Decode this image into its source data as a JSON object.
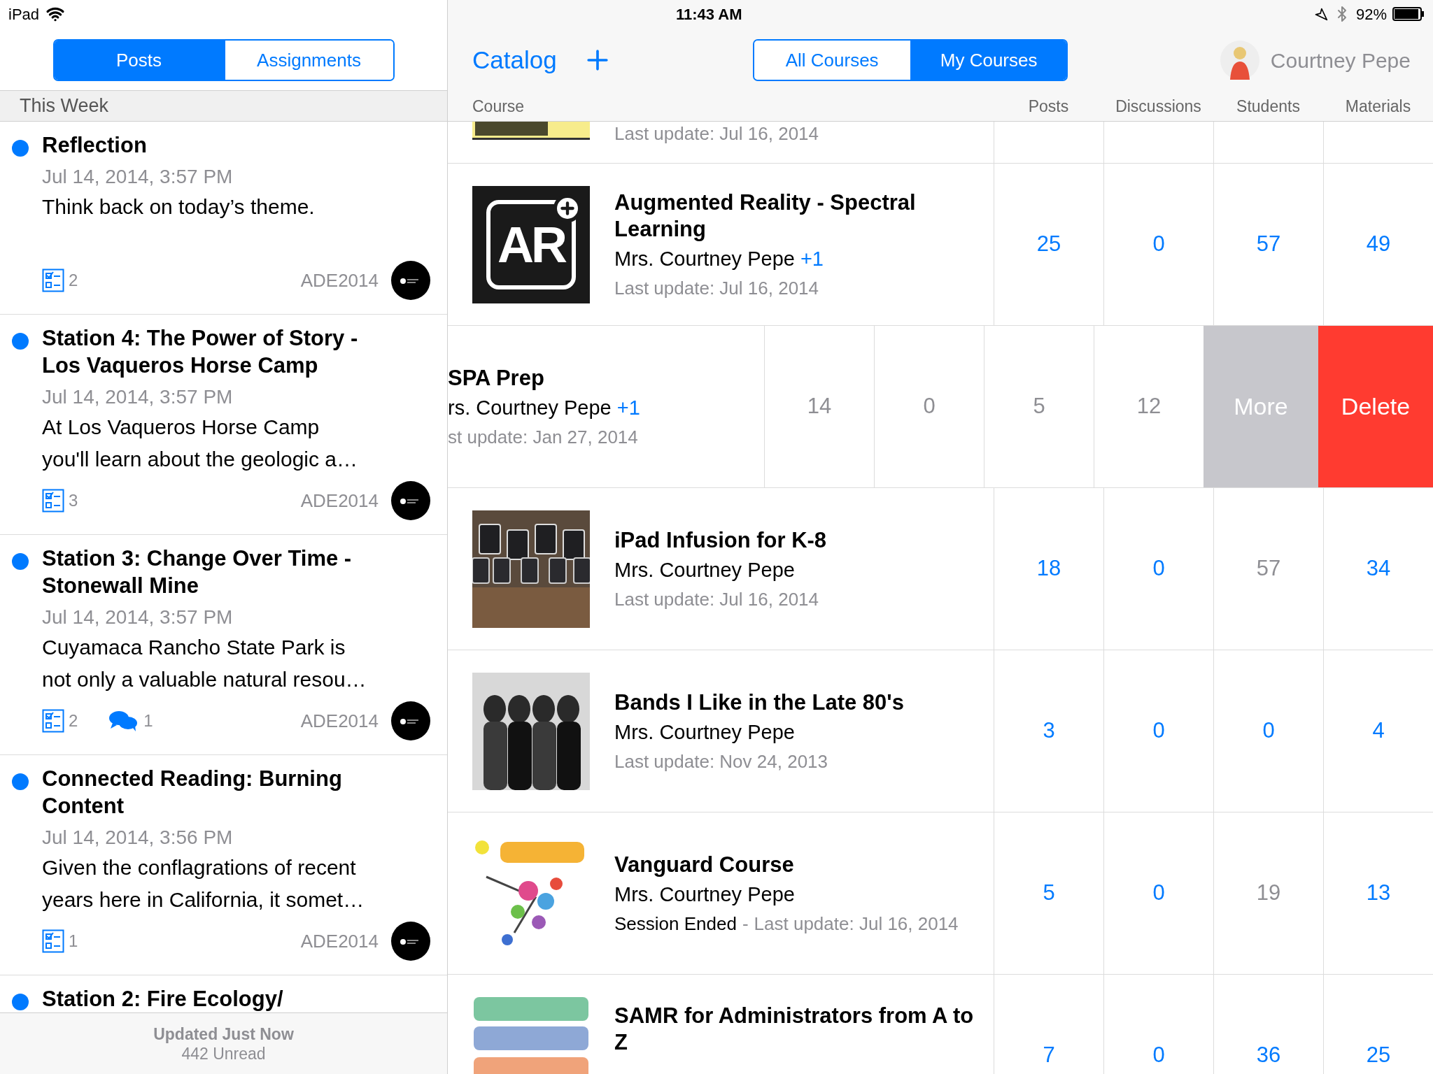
{
  "status_bar": {
    "device": "iPad",
    "time": "11:43 AM",
    "battery": "92%"
  },
  "left": {
    "tabs": [
      {
        "label": "Posts",
        "selected": true
      },
      {
        "label": "Assignments",
        "selected": false
      }
    ],
    "section": "This Week",
    "posts": [
      {
        "unread": true,
        "title_lines": [
          "Reflection"
        ],
        "date": "Jul 14, 2014, 3:57 PM",
        "body_lines": [
          "Think back on today’s theme."
        ],
        "assignments": "2",
        "group": "ADE2014"
      },
      {
        "unread": true,
        "title_lines": [
          "Station 4: The Power of Story -",
          "Los Vaqueros Horse Camp"
        ],
        "date": "Jul 14, 2014, 3:57 PM",
        "body_lines": [
          "At Los Vaqueros Horse Camp",
          "you'll learn about the geologic a…"
        ],
        "assignments": "3",
        "group": "ADE2014"
      },
      {
        "unread": true,
        "title_lines": [
          "Station 3: Change Over Time -",
          "Stonewall Mine"
        ],
        "date": "Jul 14, 2014, 3:57 PM",
        "body_lines": [
          "Cuyamaca Rancho State Park is",
          "not only a valuable natural resou…"
        ],
        "assignments": "2",
        "comments": "1",
        "group": "ADE2014"
      },
      {
        "unread": true,
        "title_lines": [
          "Connected Reading: Burning",
          "Content"
        ],
        "date": "Jul 14, 2014, 3:56 PM",
        "body_lines": [
          "Given the conflagrations of recent",
          "years here in California, it somet…"
        ],
        "assignments": "1",
        "group": "ADE2014"
      },
      {
        "unread": true,
        "title_lines": [
          "Station 2: Fire Ecology/"
        ]
      }
    ],
    "footer": {
      "updated": "Updated Just Now",
      "unread": "442 Unread"
    }
  },
  "right": {
    "title": "Catalog",
    "filters": [
      {
        "label": "All Courses",
        "selected": false
      },
      {
        "label": "My Courses",
        "selected": true
      }
    ],
    "user": "Courtney Pepe",
    "columns": [
      "Course",
      "Posts",
      "Discussions",
      "Students",
      "Materials"
    ],
    "rows": [
      {
        "kind": "partial",
        "updated": "Last update: Jul 16, 2014"
      },
      {
        "kind": "full",
        "thumbnail": {
          "kind": "logo",
          "text": "AR"
        },
        "title_lines": [
          "Augmented Reality - Spectral",
          "Learning"
        ],
        "teacher": "Mrs. Courtney Pepe",
        "extra": "+1",
        "updated": "Last update: Jul 16, 2014",
        "counts": [
          {
            "value": "25",
            "linked": true
          },
          {
            "value": "0",
            "linked": true
          },
          {
            "value": "57",
            "linked": true
          },
          {
            "value": "49",
            "linked": true
          }
        ]
      },
      {
        "kind": "swiped",
        "title_lines": [
          "SPA Prep"
        ],
        "teacher": "rs. Courtney Pepe",
        "extra": "+1",
        "updated": "st update: Jan 27, 2014",
        "counts": [
          {
            "value": "14",
            "linked": false
          },
          {
            "value": "0",
            "linked": false
          },
          {
            "value": "5",
            "linked": false
          },
          {
            "value": "12",
            "linked": false
          }
        ],
        "actions": [
          {
            "label": "More",
            "kind": "more"
          },
          {
            "label": "Delete",
            "kind": "delete"
          }
        ]
      },
      {
        "kind": "full",
        "thumbnail": {
          "kind": "ipads"
        },
        "title_lines": [
          "iPad Infusion for K-8"
        ],
        "teacher": "Mrs. Courtney Pepe",
        "updated": "Last update: Jul 16, 2014",
        "counts": [
          {
            "value": "18",
            "linked": true
          },
          {
            "value": "0",
            "linked": true
          },
          {
            "value": "57",
            "linked": false
          },
          {
            "value": "34",
            "linked": true
          }
        ]
      },
      {
        "kind": "full",
        "thumbnail": {
          "kind": "band"
        },
        "title_lines": [
          "Bands I Like in the Late 80's"
        ],
        "teacher": "Mrs. Courtney Pepe",
        "updated": "Last update: Nov 24, 2013",
        "counts": [
          {
            "value": "3",
            "linked": true
          },
          {
            "value": "0",
            "linked": true
          },
          {
            "value": "0",
            "linked": true
          },
          {
            "value": "4",
            "linked": true
          }
        ]
      },
      {
        "kind": "full",
        "thumbnail": {
          "kind": "sketch"
        },
        "title_lines": [
          "Vanguard Course"
        ],
        "teacher": "Mrs. Courtney Pepe",
        "status": "Session Ended",
        "separator": "-",
        "updated": "Last update: Jul 16, 2014",
        "counts": [
          {
            "value": "5",
            "linked": true
          },
          {
            "value": "0",
            "linked": true
          },
          {
            "value": "19",
            "linked": false
          },
          {
            "value": "13",
            "linked": true
          }
        ]
      },
      {
        "kind": "full",
        "thumbnail": {
          "kind": "bars"
        },
        "title_lines": [
          "SAMR for Administrators from A to",
          "Z"
        ],
        "counts": [
          {
            "value": "7",
            "linked": true
          },
          {
            "value": "0",
            "linked": true
          },
          {
            "value": "36",
            "linked": true
          },
          {
            "value": "25",
            "linked": true
          }
        ]
      }
    ]
  }
}
